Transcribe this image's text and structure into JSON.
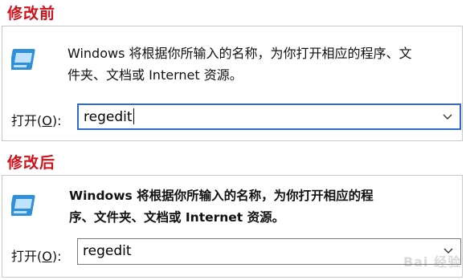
{
  "before": {
    "label": "修改前",
    "description_line1": "Windows 将根据你所输入的名称，为你打开相应的程序、文",
    "description_line2": "件夹、文档或 Internet 资源。",
    "open_label_prefix": "打开(",
    "open_label_key": "O",
    "open_label_suffix": "):",
    "input_value": "regedit"
  },
  "after": {
    "label": "修改后",
    "description_line1": "Windows 将根据你所输入的名称，为你打开相应的程",
    "description_line2": "序、文件夹、文档或 Internet 资源。",
    "open_label_prefix": "打开(",
    "open_label_key": "O",
    "open_label_suffix": "):",
    "input_value": "regedit"
  },
  "watermark": "Bai 经验",
  "colors": {
    "label_red": "#d0121b",
    "focus_blue": "#2f6ad0",
    "icon_blue": "#2f8fd8"
  }
}
